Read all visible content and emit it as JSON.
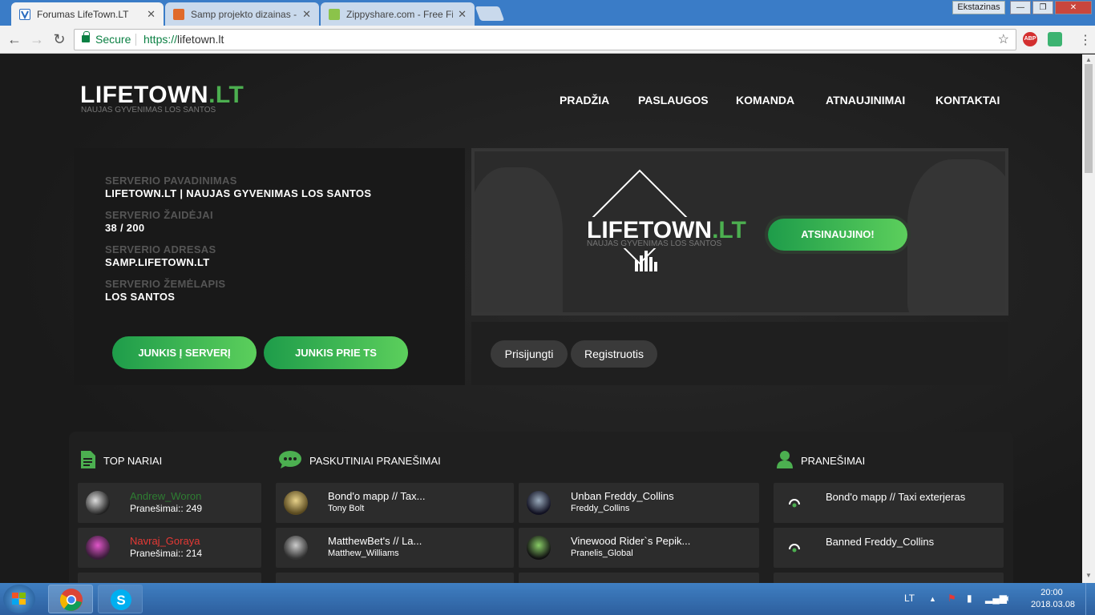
{
  "browser": {
    "tabs": [
      {
        "title": "Forumas LifeTown.LT",
        "active": true
      },
      {
        "title": "Samp projekto dizainas -",
        "active": false
      },
      {
        "title": "Zippyshare.com - Free Fi",
        "active": false
      }
    ],
    "profile": "Ekstazinas",
    "secure_label": "Secure",
    "url_scheme": "https://",
    "url_host": "lifetown.lt",
    "ext_abp": "ABP"
  },
  "site": {
    "logo_main": "LIFETOWN",
    "logo_tld": ".LT",
    "logo_tagline": "NAUJAS GYVENIMAS LOS SANTOS",
    "nav": [
      "PRADŽIA",
      "PASLAUGOS",
      "KOMANDA",
      "ATNAUJINIMAI",
      "KONTAKTAI"
    ]
  },
  "server_info": {
    "name_label": "SERVERIO PAVADINIMAS",
    "name_value": "LIFETOWN.LT | NAUJAS GYVENIMAS LOS SANTOS",
    "players_label": "SERVERIO ŽAIDĖJAI",
    "players_value": "38 / 200",
    "address_label": "SERVERIO ADRESAS",
    "address_value": "SAMP.LIFETOWN.LT",
    "map_label": "SERVERIO ŽEMĖLAPIS",
    "map_value": "LOS SANTOS",
    "join_server_btn": "JUNKIS Į SERVERĮ",
    "join_ts_btn": "JUNKIS PRIE TS"
  },
  "banner": {
    "logo_main": "LIFETOWN",
    "logo_tld": ".LT",
    "logo_tagline": "NAUJAS GYVENIMAS LOS SANTOS",
    "cta": "ATSINAUJINO!"
  },
  "auth": {
    "login": "Prisijungti",
    "register": "Registruotis"
  },
  "top_members": {
    "title": "TOP NARIAI",
    "members": [
      {
        "name": "Andrew_Woron",
        "posts": "Pranešimai:: 249",
        "color": "#2e7d32"
      },
      {
        "name": "Navraj_Goraya",
        "posts": "Pranešimai:: 214",
        "color": "#e53935"
      }
    ]
  },
  "latest_posts": {
    "title": "PASKUTINIAI PRANEŠIMAI",
    "posts": [
      {
        "topic": "Bond'o mapp // Tax...",
        "author": "Tony Bolt"
      },
      {
        "topic": "Unban Freddy_Collins",
        "author": "Freddy_Collins"
      },
      {
        "topic": "MatthewBet's // La...",
        "author": "Matthew_Williams"
      },
      {
        "topic": "Vinewood Rider`s Pepik...",
        "author": "Pranelis_Global"
      }
    ]
  },
  "reports": {
    "title": "PRANEŠIMAI",
    "items": [
      "Bond'o mapp // Taxi exterjeras",
      "Banned Freddy_Collins"
    ]
  },
  "taskbar": {
    "lang": "LT",
    "time": "20:00",
    "date": "2018.03.08"
  },
  "colors": {
    "accent": "#4caf50",
    "brand_blue": "#3a7cc7"
  }
}
